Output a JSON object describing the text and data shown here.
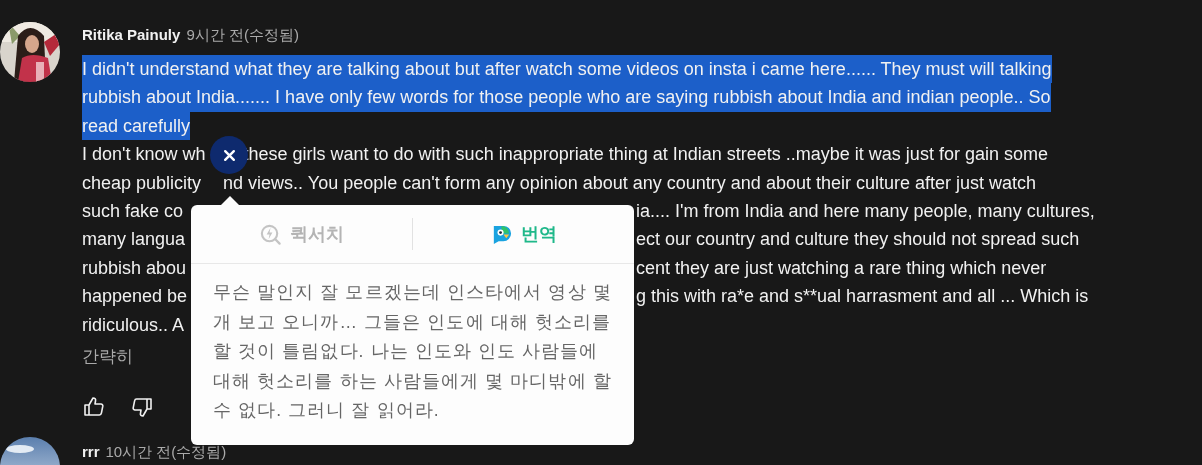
{
  "comments": [
    {
      "author": "Ritika Painuly",
      "time": "9시간 전(수정됨)",
      "selected_lines": [
        "I didn't understand what they are talking about but after watch some videos on insta i came here...... They must will talking",
        "rubbish about India....... I have only few words for those people who are saying rubbish about India and indian people.. So",
        "read carefully "
      ],
      "body_lines": [
        {
          "kind": "close-gap",
          "left": "I don't know wh",
          "right": "these girls want to do with such inappropriate thing at Indian streets ..maybe it was just for gain some"
        },
        {
          "kind": "pointer-gap",
          "left": "cheap publicity",
          "right": "nd views.. You people can't form any opinion about any country and about their culture after just watch"
        },
        {
          "kind": "popup-gap",
          "left": "such fake co",
          "right": "ia.... I'm from India and here many people, many cultures,"
        },
        {
          "kind": "popup-gap",
          "left": "many langua",
          "right": "ect our country and culture  they should not spread such"
        },
        {
          "kind": "popup-gap",
          "left": "rubbish abou",
          "right": "cent they are just watching a rare thing which never"
        },
        {
          "kind": "popup-gap",
          "left": "happened be",
          "right": "g this with ra*e and s**ual harrasment and all ... Which is"
        },
        {
          "kind": "popup-gap",
          "left": "ridiculous.. A"
        }
      ],
      "collapse_link": "간략히"
    },
    {
      "author": "rrr",
      "time": "10시간 전(수정됨)"
    }
  ],
  "translate_popup": {
    "tabs": [
      {
        "label": "퀵서치",
        "kind": "quicksearch",
        "selected": false
      },
      {
        "label": "번역",
        "kind": "translate",
        "selected": true
      }
    ],
    "translation": "무슨 말인지 잘 모르겠는데 인스타에서 영상 몇 개 보고 오니까… 그들은 인도에 대해 헛소리를 할 것이 틀림없다. 나는 인도와 인도 사람들에 대해 헛소리를 하는 사람들에게 몇 마디밖에 할 수 없다. 그러니 잘 읽어라."
  }
}
